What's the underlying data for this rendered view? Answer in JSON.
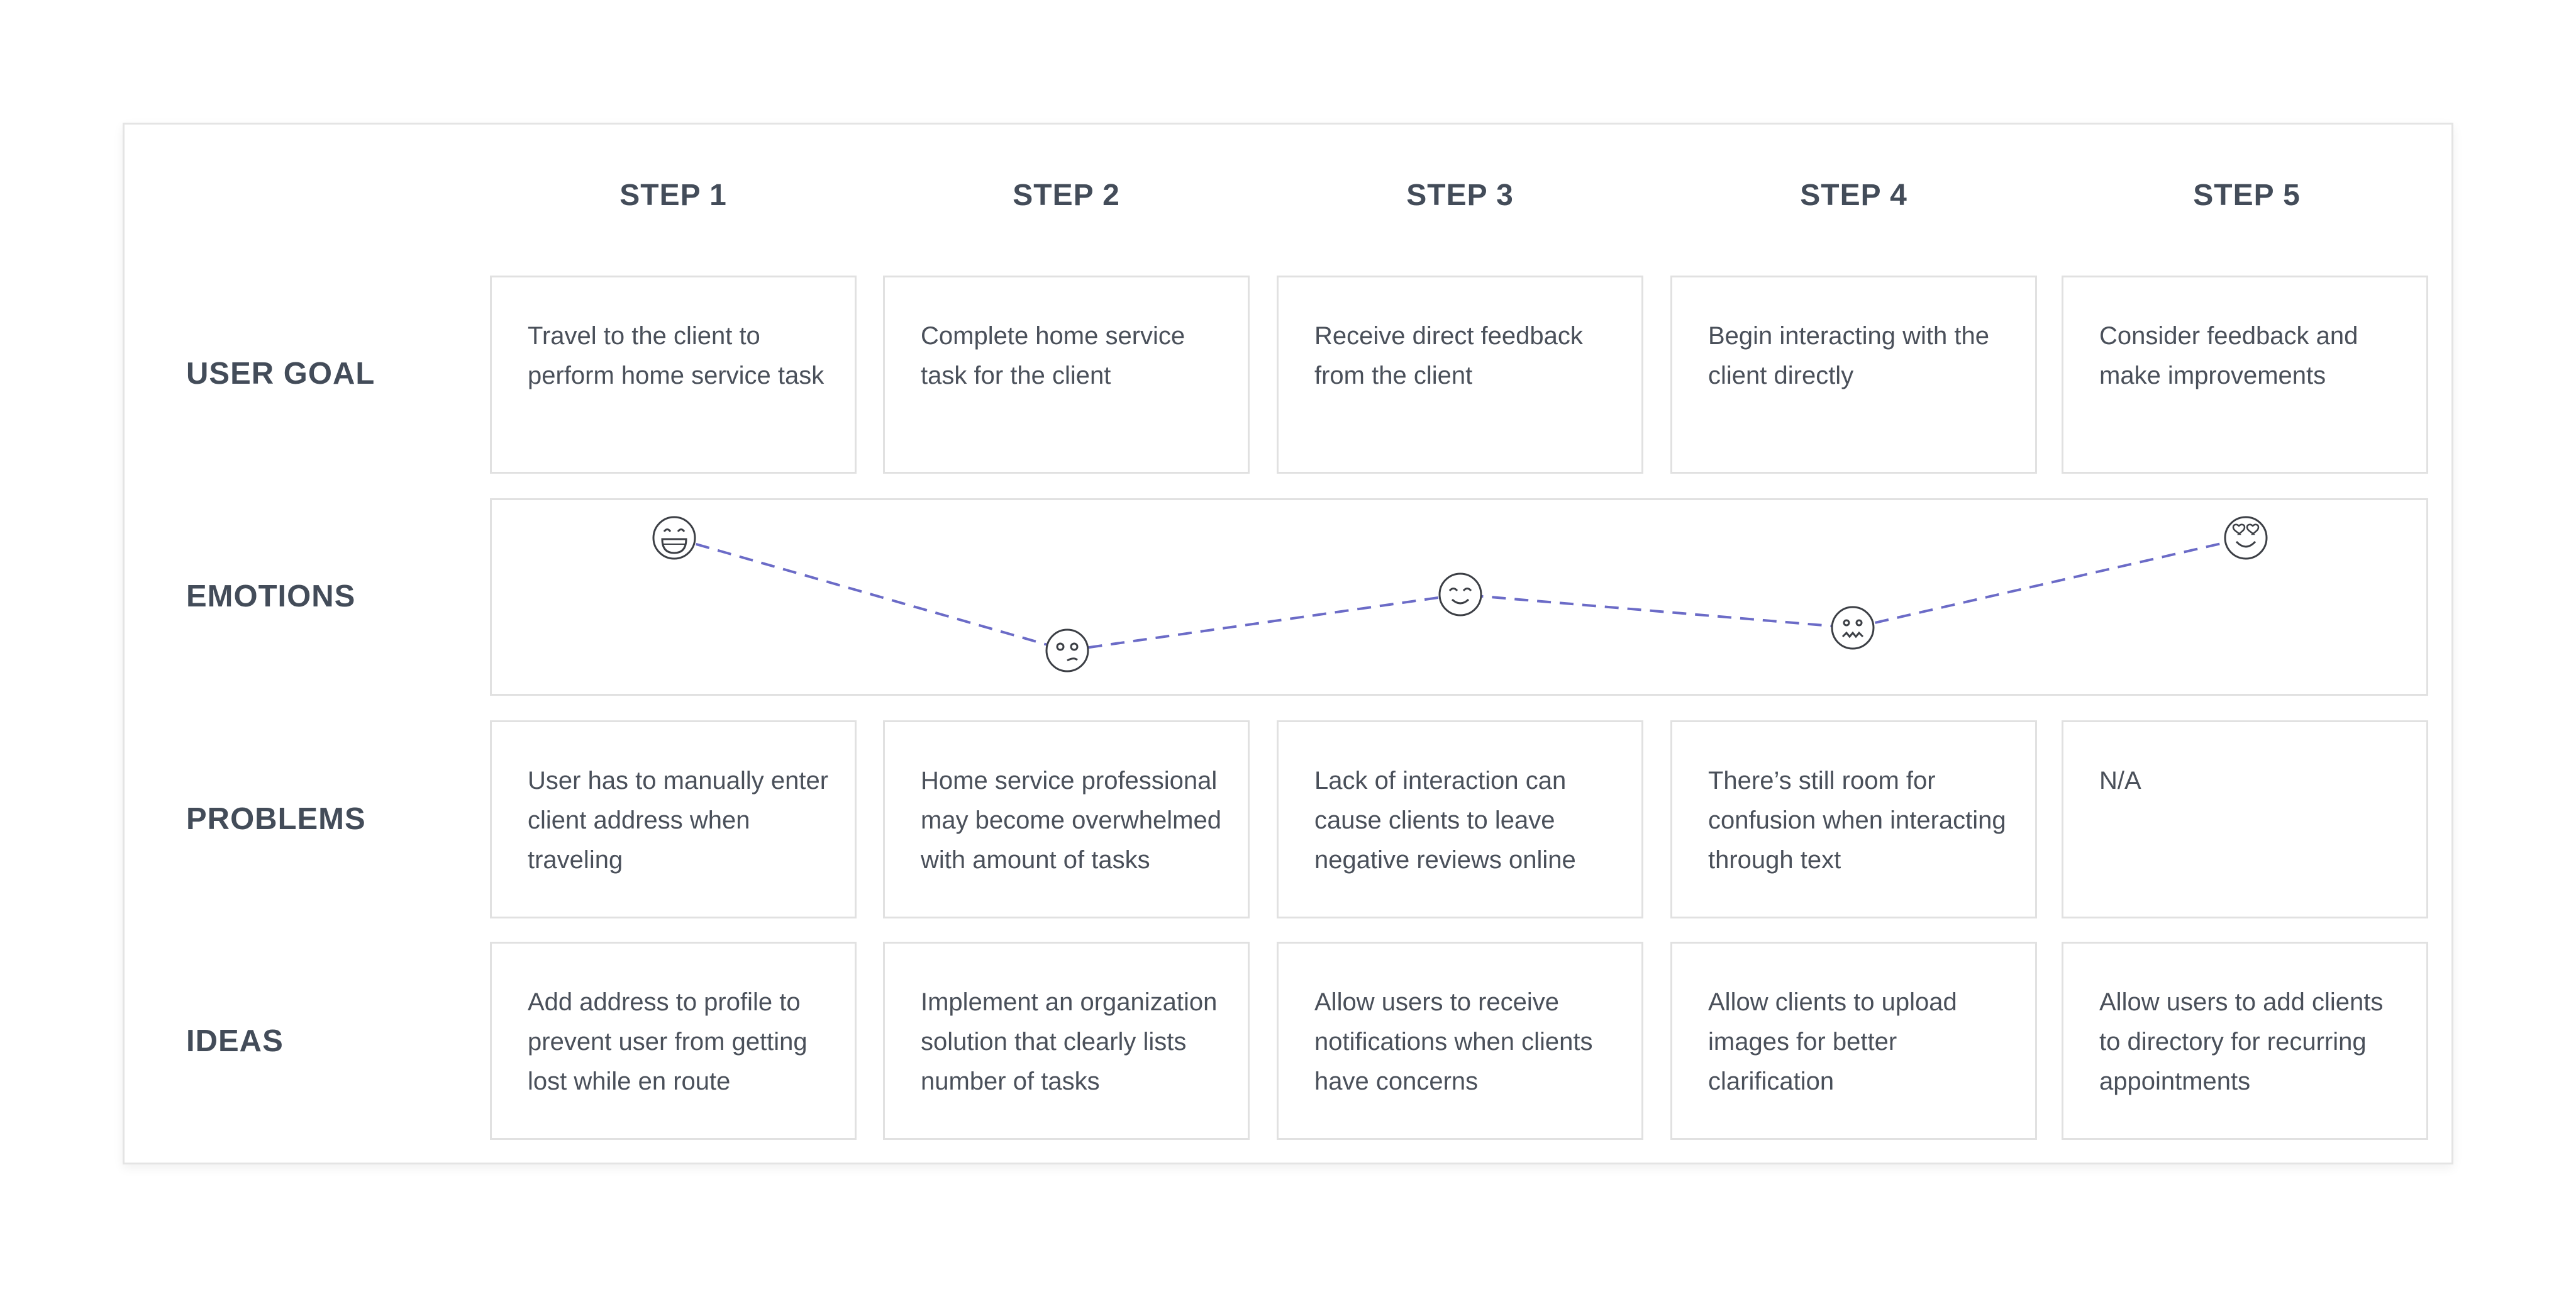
{
  "steps": [
    "STEP 1",
    "STEP 2",
    "STEP 3",
    "STEP 4",
    "STEP 5"
  ],
  "rows": {
    "user_goal": "USER GOAL",
    "emotions": "EMOTIONS",
    "problems": "PROBLEMS",
    "ideas": "IDEAS"
  },
  "user_goal": [
    "Travel to the client to perform home service task",
    "Complete home service task for the client",
    "Receive direct feedback from the client",
    "Begin interacting with the client directly",
    "Consider feedback and make improvements"
  ],
  "problems": [
    "User has to manually enter client address when traveling",
    "Home service professional may become overwhelmed with amount of tasks",
    "Lack of interaction can cause clients to leave negative reviews online",
    "There’s still room for confusion when interacting through text",
    "N/A"
  ],
  "ideas": [
    "Add address to profile to prevent user from getting lost while en route",
    "Implement an organization solution that clearly lists number of tasks",
    "Allow users to receive notifications when clients have concerns",
    "Allow clients to upload images for better clarification",
    "Allow users to add clients to directory for recurring appointments"
  ],
  "emotions": [
    {
      "step": "STEP 1",
      "icon": "grinning-face-icon"
    },
    {
      "step": "STEP 2",
      "icon": "confused-face-icon"
    },
    {
      "step": "STEP 3",
      "icon": "content-face-icon"
    },
    {
      "step": "STEP 4",
      "icon": "worried-face-icon"
    },
    {
      "step": "STEP 5",
      "icon": "heart-eyes-face-icon"
    }
  ],
  "colors": {
    "emotion_line": "#6b6bc7",
    "text": "#434c59",
    "border": "#e1e1e1"
  }
}
